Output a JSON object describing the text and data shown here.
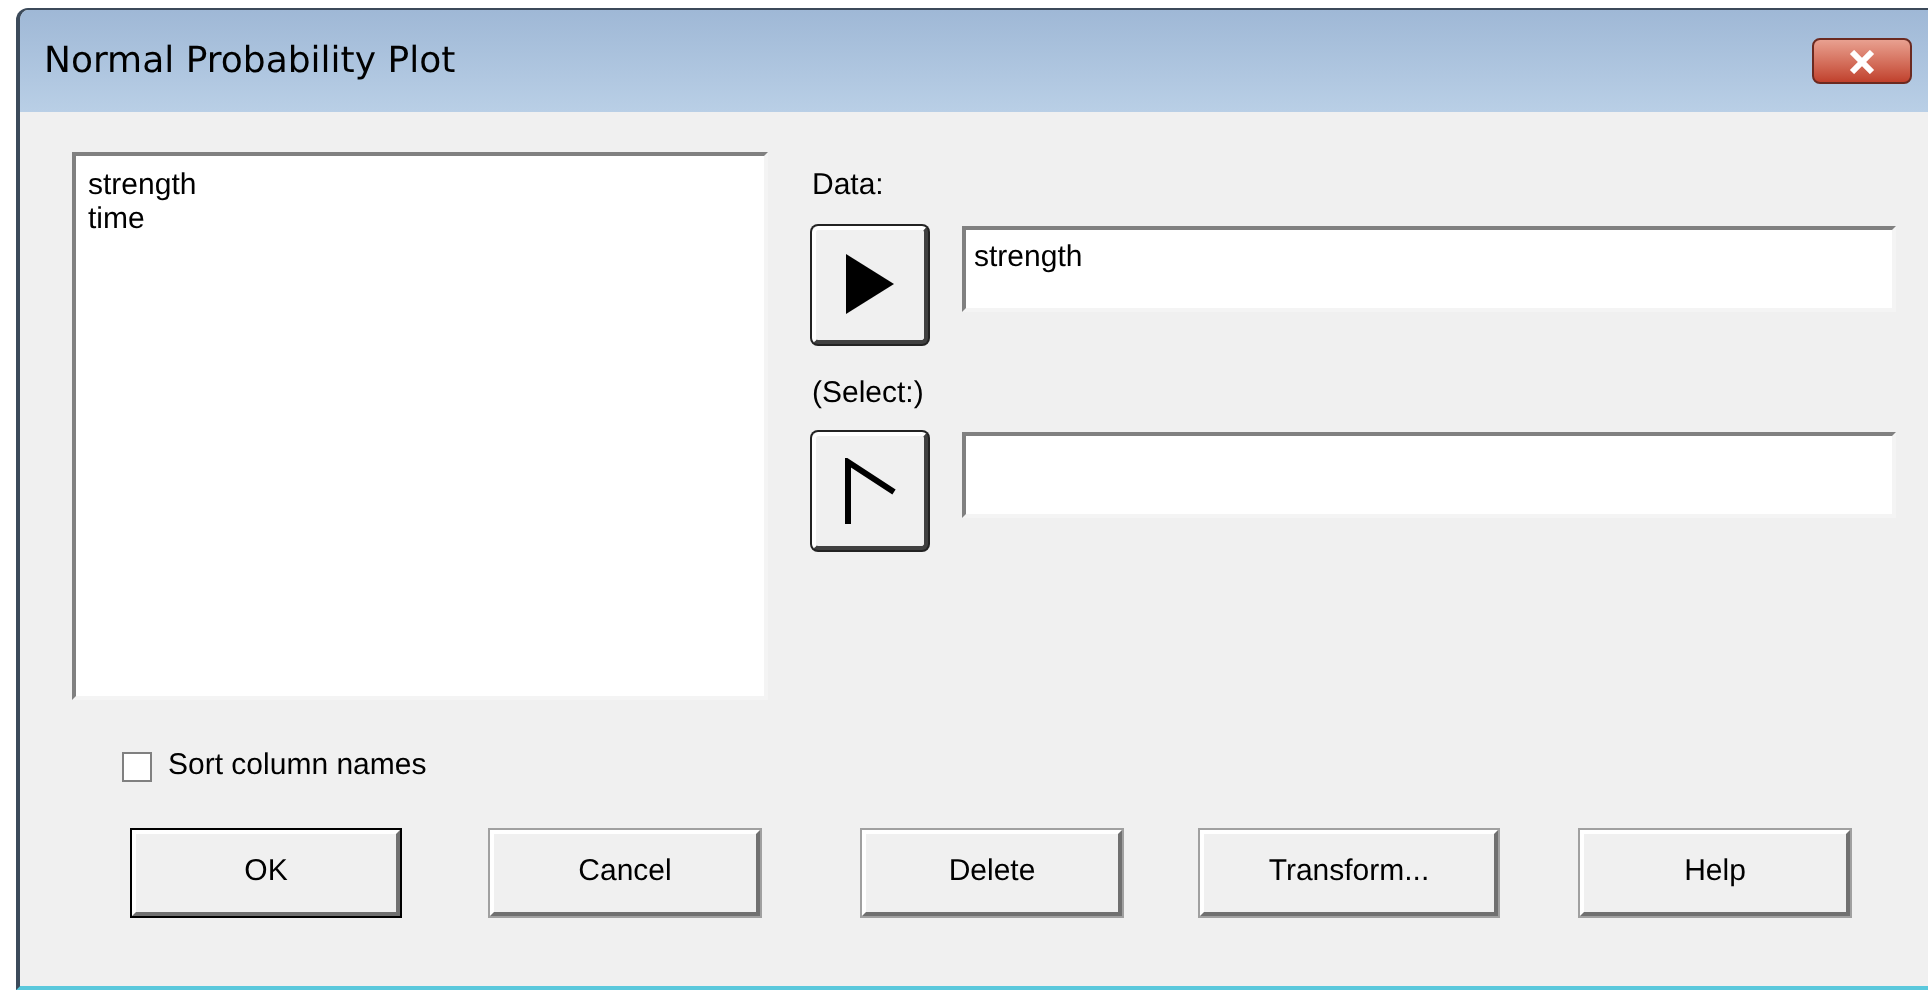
{
  "window": {
    "title": "Normal Probability Plot"
  },
  "columns_list": {
    "items": [
      "strength",
      "time"
    ]
  },
  "fields": [
    {
      "label": "Data:",
      "value": "strength"
    },
    {
      "label": "(Select:)"
    }
  ],
  "sort_column_names": {
    "label": "Sort column names",
    "checked": false
  },
  "buttons": [
    {
      "label": "OK",
      "default": true
    },
    {
      "label": "Cancel",
      "default": false
    },
    {
      "label": "Delete",
      "default": false
    },
    {
      "label": "Transform...",
      "default": false
    },
    {
      "label": "Help",
      "default": false
    }
  ]
}
